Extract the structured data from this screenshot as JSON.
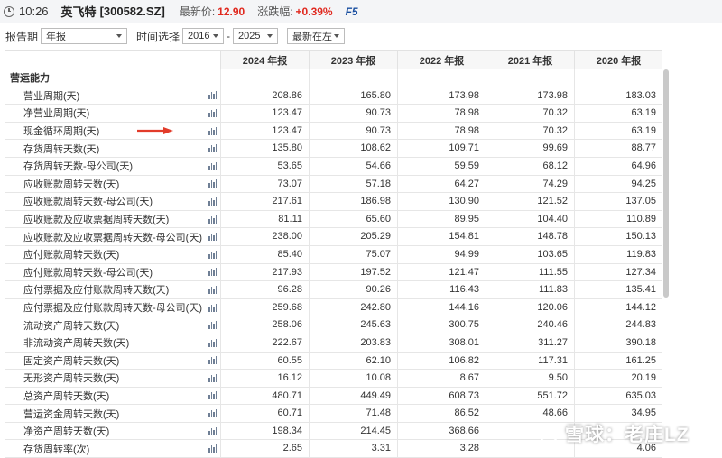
{
  "header": {
    "time": "10:26",
    "stock_name": "英飞特",
    "stock_code": "[300582.SZ]",
    "price_label": "最新价:",
    "price": "12.90",
    "change_label": "涨跌幅:",
    "change": "+0.39%",
    "f5": "F5",
    "accent": "#e0281e"
  },
  "filters": {
    "period_label": "报告期",
    "period_value": "年报",
    "range_label": "时间选择",
    "from": "2016",
    "sep": "-",
    "to": "2025",
    "order": "最新在左"
  },
  "table": {
    "columns": [
      "2024 年报",
      "2023 年报",
      "2022 年报",
      "2021 年报",
      "2020 年报"
    ],
    "section": "营运能力",
    "rows": [
      {
        "label": "营业周期(天)",
        "values": [
          "208.86",
          "165.80",
          "173.98",
          "173.98",
          "183.03"
        ]
      },
      {
        "label": "净营业周期(天)",
        "values": [
          "123.47",
          "90.73",
          "78.98",
          "70.32",
          "63.19"
        ]
      },
      {
        "label": "现金循环周期(天)",
        "values": [
          "123.47",
          "90.73",
          "78.98",
          "70.32",
          "63.19"
        ]
      },
      {
        "label": "存货周转天数(天)",
        "values": [
          "135.80",
          "108.62",
          "109.71",
          "99.69",
          "88.77"
        ]
      },
      {
        "label": "存货周转天数-母公司(天)",
        "values": [
          "53.65",
          "54.66",
          "59.59",
          "68.12",
          "64.96"
        ]
      },
      {
        "label": "应收账款周转天数(天)",
        "values": [
          "73.07",
          "57.18",
          "64.27",
          "74.29",
          "94.25"
        ]
      },
      {
        "label": "应收账款周转天数-母公司(天)",
        "values": [
          "217.61",
          "186.98",
          "130.90",
          "121.52",
          "137.05"
        ]
      },
      {
        "label": "应收账款及应收票据周转天数(天)",
        "values": [
          "81.11",
          "65.60",
          "89.95",
          "104.40",
          "110.89"
        ]
      },
      {
        "label": "应收账款及应收票据周转天数-母公司(天)",
        "values": [
          "238.00",
          "205.29",
          "154.81",
          "148.78",
          "150.13"
        ]
      },
      {
        "label": "应付账款周转天数(天)",
        "values": [
          "85.40",
          "75.07",
          "94.99",
          "103.65",
          "119.83"
        ]
      },
      {
        "label": "应付账款周转天数-母公司(天)",
        "values": [
          "217.93",
          "197.52",
          "121.47",
          "111.55",
          "127.34"
        ]
      },
      {
        "label": "应付票据及应付账款周转天数(天)",
        "values": [
          "96.28",
          "90.26",
          "116.43",
          "111.83",
          "135.41"
        ]
      },
      {
        "label": "应付票据及应付账款周转天数-母公司(天)",
        "values": [
          "259.68",
          "242.80",
          "144.16",
          "120.06",
          "144.12"
        ]
      },
      {
        "label": "流动资产周转天数(天)",
        "values": [
          "258.06",
          "245.63",
          "300.75",
          "240.46",
          "244.83"
        ]
      },
      {
        "label": "非流动资产周转天数(天)",
        "values": [
          "222.67",
          "203.83",
          "308.01",
          "311.27",
          "390.18"
        ]
      },
      {
        "label": "固定资产周转天数(天)",
        "values": [
          "60.55",
          "62.10",
          "106.82",
          "117.31",
          "161.25"
        ]
      },
      {
        "label": "无形资产周转天数(天)",
        "values": [
          "16.12",
          "10.08",
          "8.67",
          "9.50",
          "20.19"
        ]
      },
      {
        "label": "总资产周转天数(天)",
        "values": [
          "480.71",
          "449.49",
          "608.73",
          "551.72",
          "635.03"
        ]
      },
      {
        "label": "营运资金周转天数(天)",
        "values": [
          "60.71",
          "71.48",
          "86.52",
          "48.66",
          "34.95"
        ]
      },
      {
        "label": "净资产周转天数(天)",
        "values": [
          "198.34",
          "214.45",
          "368.66",
          "",
          ""
        ]
      },
      {
        "label": "存货周转率(次)",
        "values": [
          "2.65",
          "3.31",
          "3.28",
          "",
          "4.06"
        ]
      }
    ]
  },
  "watermark": "雪球：老庄LZ"
}
